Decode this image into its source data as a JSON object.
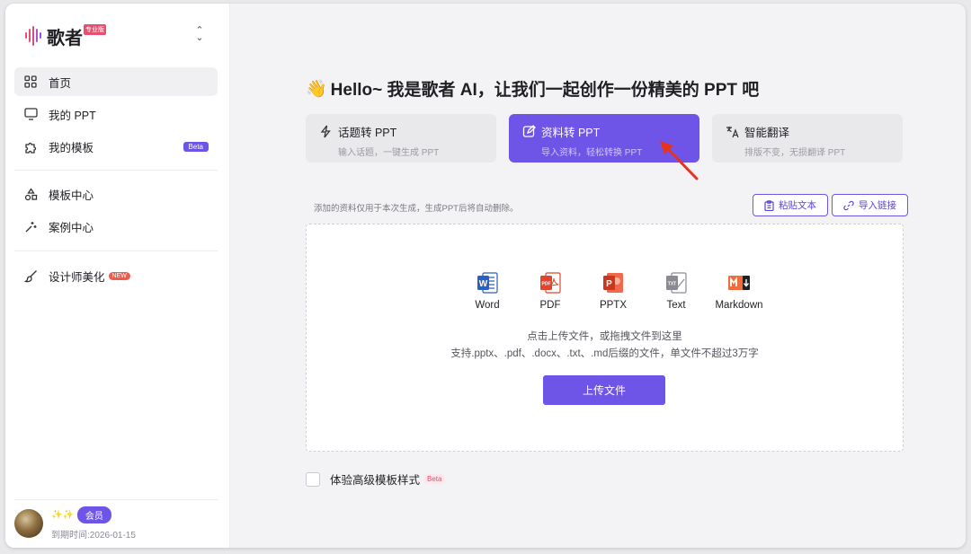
{
  "app": {
    "name": "歌者",
    "badge": "专业版"
  },
  "sidebar": {
    "items": [
      {
        "label": "首页",
        "icon": "grid-icon",
        "active": true
      },
      {
        "label": "我的 PPT",
        "icon": "monitor-icon"
      },
      {
        "label": "我的模板",
        "icon": "puzzle-icon",
        "tag": "Beta"
      },
      {
        "label": "模板中心",
        "icon": "shapes-icon"
      },
      {
        "label": "案例中心",
        "icon": "sparkles-icon"
      },
      {
        "label": "设计师美化",
        "icon": "brush-icon",
        "tag": "NEW"
      }
    ]
  },
  "user": {
    "sparkle": "✨✨",
    "member_label": "会员",
    "expire_text": "到期时间:2026-01-15"
  },
  "main": {
    "wave": "👋",
    "headline": "Hello~ 我是歌者 AI，让我们一起创作一份精美的 PPT 吧",
    "modes": [
      {
        "title": "话题转 PPT",
        "subtitle": "输入话题，一键生成 PPT",
        "icon": "topic-icon"
      },
      {
        "title": "资料转 PPT",
        "subtitle": "导入资料，轻松转换 PPT",
        "icon": "edit-icon",
        "active": true
      },
      {
        "title": "智能翻译",
        "subtitle": "排版不变，无损翻译 PPT",
        "icon": "translate-icon"
      }
    ],
    "notice": "添加的资料仅用于本次生成，生成PPT后将自动删除。",
    "paste_text": "粘贴文本",
    "import_link": "导入链接",
    "formats": [
      "Word",
      "PDF",
      "PPTX",
      "Text",
      "Markdown"
    ],
    "drop_hint_1": "点击上传文件，或拖拽文件到这里",
    "drop_hint_2": "支持.pptx、.pdf、.docx、.txt、.md后缀的文件，单文件不超过3万字",
    "upload_button": "上传文件",
    "advanced_label": "体验高级模板样式",
    "advanced_tag": "Beta"
  },
  "colors": {
    "accent": "#6e55e8",
    "annotation_arrow": "#e8321f"
  }
}
